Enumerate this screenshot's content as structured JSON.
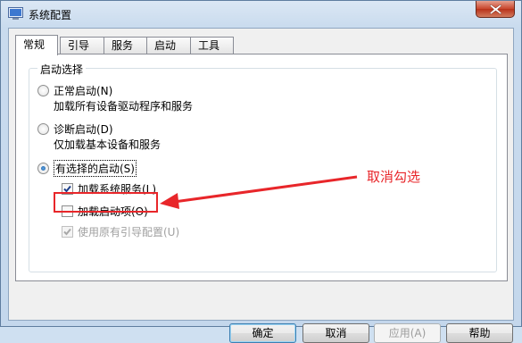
{
  "window": {
    "title": "系统配置"
  },
  "tabs": [
    {
      "label": "常规"
    },
    {
      "label": "引导"
    },
    {
      "label": "服务"
    },
    {
      "label": "启动"
    },
    {
      "label": "工具"
    }
  ],
  "startup_group": {
    "title": "启动选择",
    "normal": {
      "label": "正常启动(N)",
      "desc": "加载所有设备驱动程序和服务"
    },
    "diagnostic": {
      "label": "诊断启动(D)",
      "desc": "仅加载基本设备和服务"
    },
    "selective": {
      "label": "有选择的启动(S)"
    },
    "options": {
      "system_services": {
        "label": "加载系统服务(L)",
        "checked": true
      },
      "startup_items": {
        "label": "加载启动项(O)",
        "checked": false
      },
      "original_boot": {
        "label": "使用原有引导配置(U)",
        "checked": true
      }
    }
  },
  "annotation": {
    "text": "取消勾选",
    "color": "#e8262a"
  },
  "buttons": {
    "ok": "确定",
    "cancel": "取消",
    "apply": "应用(A)",
    "help": "帮助"
  }
}
